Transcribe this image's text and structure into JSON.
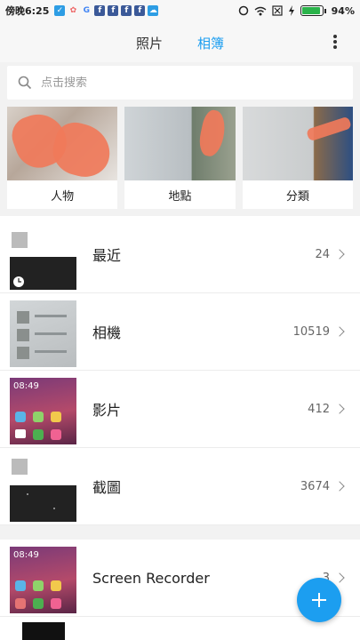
{
  "status_bar": {
    "time": "傍晚6:25",
    "battery": "94%",
    "battery_level": 0.94
  },
  "header": {
    "tabs": [
      {
        "label": "照片",
        "active": false
      },
      {
        "label": "相簿",
        "active": true
      }
    ],
    "more_icon": "more-vert-icon"
  },
  "search": {
    "placeholder": "点击搜索"
  },
  "categories": [
    {
      "label": "人物"
    },
    {
      "label": "地點"
    },
    {
      "label": "分類"
    }
  ],
  "albums": [
    {
      "name": "最近",
      "count": "24"
    },
    {
      "name": "相機",
      "count": "10519"
    },
    {
      "name": "影片",
      "count": "412"
    },
    {
      "name": "截圖",
      "count": "3674"
    }
  ],
  "albums2": [
    {
      "name": "Screen Recorder",
      "count": "3"
    }
  ],
  "colors": {
    "accent": "#1c9ef0",
    "background": "#f2f2f2"
  }
}
